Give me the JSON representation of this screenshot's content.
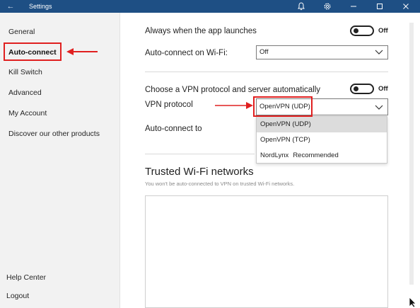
{
  "window": {
    "title": "Settings",
    "back_icon": "arrow-left-icon",
    "bell_icon": "bell-icon",
    "gear_icon": "gear-icon",
    "controls": [
      "minimize-icon",
      "maximize-icon",
      "close-icon"
    ],
    "titlebar_color": "#1e4f84"
  },
  "sidebar": {
    "items": [
      {
        "label": "General"
      },
      {
        "label": "Auto-connect",
        "active": true
      },
      {
        "label": "Kill Switch"
      },
      {
        "label": "Advanced"
      },
      {
        "label": "My Account"
      },
      {
        "label": "Discover our other products"
      }
    ],
    "footer": [
      {
        "label": "Help Center"
      },
      {
        "label": "Logout"
      }
    ]
  },
  "main": {
    "launch": {
      "label": "Always when the app launches",
      "toggle_state": "Off"
    },
    "wifi": {
      "label": "Auto-connect on Wi-Fi:",
      "value": "Off"
    },
    "protocol_auto": {
      "label": "Choose a VPN protocol and server automatically",
      "toggle_state": "Off"
    },
    "vpn_protocol": {
      "label": "VPN protocol",
      "value": "OpenVPN (UDP)",
      "options": [
        {
          "label": "OpenVPN (UDP)",
          "selected": true
        },
        {
          "label": "OpenVPN (TCP)"
        },
        {
          "label": "NordLynx",
          "badge": "Recommended"
        }
      ]
    },
    "autoconnect_to": {
      "label": "Auto-connect to"
    },
    "trusted": {
      "title": "Trusted Wi-Fi networks",
      "subtitle": "You won't be auto-connected to VPN on trusted Wi-Fi networks."
    }
  },
  "annotations": {
    "highlight_color": "#e02020"
  }
}
